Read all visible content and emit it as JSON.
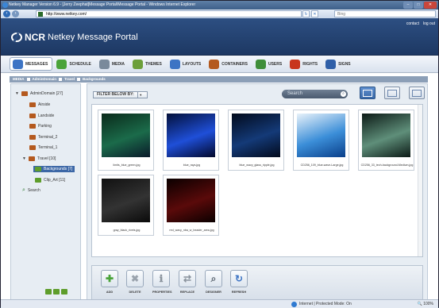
{
  "window": {
    "title": "Netkey Manager Version 6.9 - [Jerry Zeephat]Message Portal\\Message Portal - Windows Internet Explorer"
  },
  "browser": {
    "url": "http://www.netkey.com/",
    "search_placeholder": "Bing"
  },
  "header": {
    "brand": "NCR",
    "brand_sub": "Netkey Message Portal",
    "links": [
      "contact",
      "log out"
    ]
  },
  "tabs": [
    {
      "label": "MESSAGES",
      "icon": "messages-icon",
      "color": "#3d74c4"
    },
    {
      "label": "SCHEDULE",
      "icon": "schedule-icon",
      "color": "#4aa33a"
    },
    {
      "label": "MEDIA",
      "icon": "media-icon",
      "color": "#7a8a9b"
    },
    {
      "label": "THEMES",
      "icon": "themes-icon",
      "color": "#6c9f3a"
    },
    {
      "label": "LAYOUTS",
      "icon": "layouts-icon",
      "color": "#3d74c4"
    },
    {
      "label": "CONTAINERS",
      "icon": "containers-icon",
      "color": "#b4591e"
    },
    {
      "label": "USERS",
      "icon": "users-icon",
      "color": "#3f8e3a"
    },
    {
      "label": "RIGHTS",
      "icon": "rights-icon",
      "color": "#c8361d"
    },
    {
      "label": "SIGNS",
      "icon": "signs-icon",
      "color": "#2f5fa8"
    }
  ],
  "breadcrumb": [
    "MEDIA",
    "AdminDomain",
    "Travel",
    "Backgrounds"
  ],
  "tree": [
    {
      "label": "AdminDomain [27]",
      "expander": "▼"
    },
    {
      "label": "Airside"
    },
    {
      "label": "Landside"
    },
    {
      "label": "Parking"
    },
    {
      "label": "Terminal_2"
    },
    {
      "label": "Terminal_1"
    },
    {
      "label": "Travel [10]",
      "expander": "▼"
    },
    {
      "label": "Backgrounds [7]"
    },
    {
      "label": "Clip_Art [11]"
    },
    {
      "label": "Search"
    }
  ],
  "filter": {
    "label": "FILTER BELOW BY:",
    "dropdown": "▼"
  },
  "search": {
    "placeholder": "Search"
  },
  "media_items": [
    {
      "caption": "limits_blue_green.jpg",
      "colors": [
        "#0a2a1a",
        "#1b6b4a",
        "#0a1a2a"
      ]
    },
    {
      "caption": "blue_rays.jpg",
      "colors": [
        "#03103a",
        "#1f4fd8",
        "#02082a"
      ]
    },
    {
      "caption": "blue_wavy_glass_ripple.jpg",
      "colors": [
        "#020a1c",
        "#143a78",
        "#020a1c"
      ]
    },
    {
      "caption": "CD256_109_blue-wave-Large.jpg",
      "colors": [
        "#e8f2fa",
        "#3b8ed8",
        "#0a3f8a"
      ]
    },
    {
      "caption": "CD256_33_tech-background-Medium.jpg",
      "colors": [
        "#0c1a16",
        "#5f8f7a",
        "#0c1a16"
      ]
    },
    {
      "caption": "gray_black_rivets.jpg",
      "colors": [
        "#111111",
        "#333333",
        "#0a0a0a"
      ]
    },
    {
      "caption": "red_wavy_nba_w_header_area.jpg",
      "colors": [
        "#0a0000",
        "#5a0a0a",
        "#0a0000"
      ]
    }
  ],
  "toolbar": [
    {
      "label": "ADD",
      "glyph": "✚",
      "color": "#4aa33a"
    },
    {
      "label": "DELETE",
      "glyph": "✖",
      "color": "#9aa3ad"
    },
    {
      "label": "PROPERTIES",
      "glyph": "ℹ",
      "color": "#8a939d"
    },
    {
      "label": "REPLACE",
      "glyph": "⇄",
      "color": "#8a939d"
    },
    {
      "label": "DESIGNER",
      "glyph": "⌕",
      "color": "#5b6570"
    },
    {
      "label": "REFRESH",
      "glyph": "↻",
      "color": "#3d74c4"
    }
  ],
  "status": {
    "zone": "Internet | Protected Mode: On",
    "zoom": "100%"
  }
}
